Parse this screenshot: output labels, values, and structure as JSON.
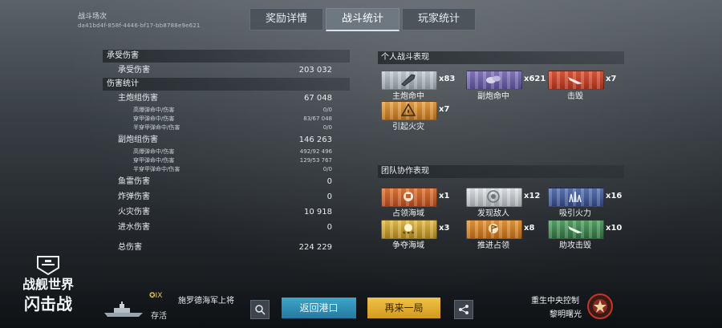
{
  "header": {
    "battle_label": "战斗场次",
    "battle_id": "da41bd4f-858f-4446-bf17-bb8788e9e621",
    "tabs": [
      {
        "label": "奖励详情",
        "active": false
      },
      {
        "label": "战斗统计",
        "active": true
      },
      {
        "label": "玩家统计",
        "active": false
      }
    ]
  },
  "damage_received": {
    "title": "承受伤害",
    "row": {
      "label": "承受伤害",
      "value": "203 032"
    }
  },
  "damage_stats": {
    "title": "伤害统计",
    "main_battery": {
      "label": "主炮组伤害",
      "value": "67 048"
    },
    "main_sub": [
      {
        "label": "高爆弹命中/伤害",
        "value": "0/0"
      },
      {
        "label": "穿甲弹命中/伤害",
        "value": "83/67 048"
      },
      {
        "label": "半穿甲弹命中/伤害",
        "value": "0/0"
      }
    ],
    "secondary_battery": {
      "label": "副炮组伤害",
      "value": "146 263"
    },
    "secondary_sub": [
      {
        "label": "高爆弹命中/伤害",
        "value": "492/92 496"
      },
      {
        "label": "穿甲弹命中/伤害",
        "value": "129/53 767"
      },
      {
        "label": "半穿甲弹命中/伤害",
        "value": "0/0"
      }
    ],
    "torpedo": {
      "label": "鱼雷伤害",
      "value": "0"
    },
    "bomb": {
      "label": "炸弹伤害",
      "value": "0"
    },
    "fire": {
      "label": "火灾伤害",
      "value": "10 918"
    },
    "flooding": {
      "label": "进水伤害",
      "value": "0"
    },
    "total": {
      "label": "总伤害",
      "value": "224 229"
    }
  },
  "personal": {
    "title": "个人战斗表现",
    "ribbons": [
      {
        "label": "主炮命中",
        "count": "x83",
        "color": "#aeb7bf",
        "icon": "shell-icon"
      },
      {
        "label": "副炮命中",
        "count": "x621",
        "color": "#6f62a8",
        "icon": "secondary-shell-icon"
      },
      {
        "label": "击毁",
        "count": "x7",
        "color": "#c9442a",
        "icon": "sinking-ship-icon"
      },
      {
        "label": "引起火灾",
        "count": "x7",
        "color": "#d08731",
        "icon": "fire-icon"
      }
    ]
  },
  "team": {
    "title": "团队协作表现",
    "ribbons": [
      {
        "label": "占领海域",
        "count": "x1",
        "color": "#c55f2a",
        "icon": "flag-icon"
      },
      {
        "label": "发现敌人",
        "count": "x12",
        "color": "#c3c8cc",
        "icon": "spotting-icon"
      },
      {
        "label": "吸引火力",
        "count": "x16",
        "color": "#465f9c",
        "icon": "splash-icon"
      },
      {
        "label": "争夺海域",
        "count": "x3",
        "color": "#c89d33",
        "icon": "stars-icon"
      },
      {
        "label": "推进占领",
        "count": "x8",
        "color": "#cf8227",
        "icon": "capture-flag-icon"
      },
      {
        "label": "助攻击毁",
        "count": "x10",
        "color": "#3f8a52",
        "icon": "assist-icon"
      }
    ]
  },
  "footer": {
    "rank": "IX",
    "commander": "施罗德海军上将",
    "status": "存活",
    "return_button": "返回港口",
    "again_button": "再来一局",
    "map_name": "重生中央控制",
    "map_mode": "黎明曙光",
    "logo_line1": "战舰世界",
    "logo_line2": "闪击战"
  }
}
